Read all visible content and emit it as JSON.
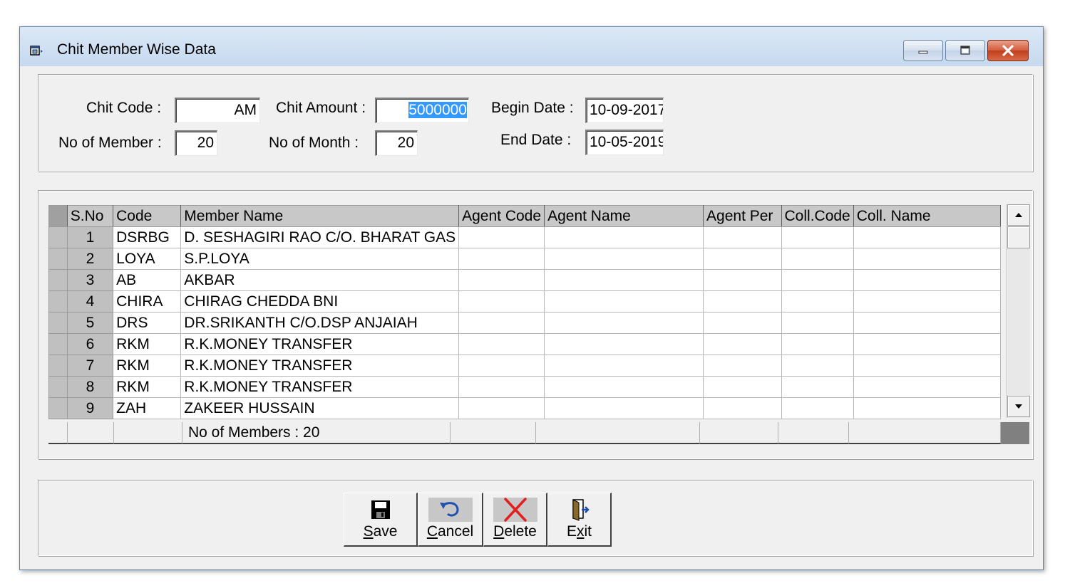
{
  "window": {
    "title": "Chit Member Wise Data"
  },
  "form": {
    "chit_code_label": "Chit Code :",
    "chit_code_value": "AM",
    "chit_amount_label": "Chit Amount :",
    "chit_amount_value": "5000000",
    "begin_date_label": "Begin Date :",
    "begin_date_value": "10-09-2017",
    "no_of_member_label": "No of Member :",
    "no_of_member_value": "20",
    "no_of_month_label": "No of Month :",
    "no_of_month_value": "20",
    "end_date_label": "End Date :",
    "end_date_value": "10-05-2019"
  },
  "grid": {
    "columns": [
      "S.No",
      "Code",
      "Member Name",
      "Agent Code",
      "Agent Name",
      "Agent Per",
      "Coll.Code",
      "Coll. Name"
    ],
    "rows": [
      [
        "1",
        "DSRBG",
        "D. SESHAGIRI RAO C/O. BHARAT GAS",
        "",
        "",
        "",
        "",
        ""
      ],
      [
        "2",
        "LOYA",
        "S.P.LOYA",
        "",
        "",
        "",
        "",
        ""
      ],
      [
        "3",
        "AB",
        "AKBAR",
        "",
        "",
        "",
        "",
        ""
      ],
      [
        "4",
        "CHIRA",
        "CHIRAG CHEDDA BNI",
        "",
        "",
        "",
        "",
        ""
      ],
      [
        "5",
        "DRS",
        "DR.SRIKANTH C/O.DSP ANJAIAH",
        "",
        "",
        "",
        "",
        ""
      ],
      [
        "6",
        "RKM",
        "R.K.MONEY TRANSFER",
        "",
        "",
        "",
        "",
        ""
      ],
      [
        "7",
        "RKM",
        "R.K.MONEY TRANSFER",
        "",
        "",
        "",
        "",
        ""
      ],
      [
        "8",
        "RKM",
        "R.K.MONEY TRANSFER",
        "",
        "",
        "",
        "",
        ""
      ],
      [
        "9",
        "ZAH",
        "ZAKEER HUSSAIN",
        "",
        "",
        "",
        "",
        ""
      ]
    ],
    "footer_text": "No of Members : 20"
  },
  "buttons": {
    "save": {
      "label_u": "S",
      "label_rest": "ave",
      "icon": "floppy-disk-icon"
    },
    "cancel": {
      "label_u": "C",
      "label_rest": "ancel",
      "icon": "undo-arrow-icon"
    },
    "delete": {
      "label_u": "D",
      "label_rest": "elete",
      "icon": "red-x-icon"
    },
    "exit": {
      "label_pre": "E",
      "label_u": "x",
      "label_rest": "it",
      "icon": "door-exit-icon"
    }
  },
  "colors": {
    "title_bg": "#c6d9ef",
    "selection": "#3399ff",
    "delete_red": "#e02020"
  }
}
